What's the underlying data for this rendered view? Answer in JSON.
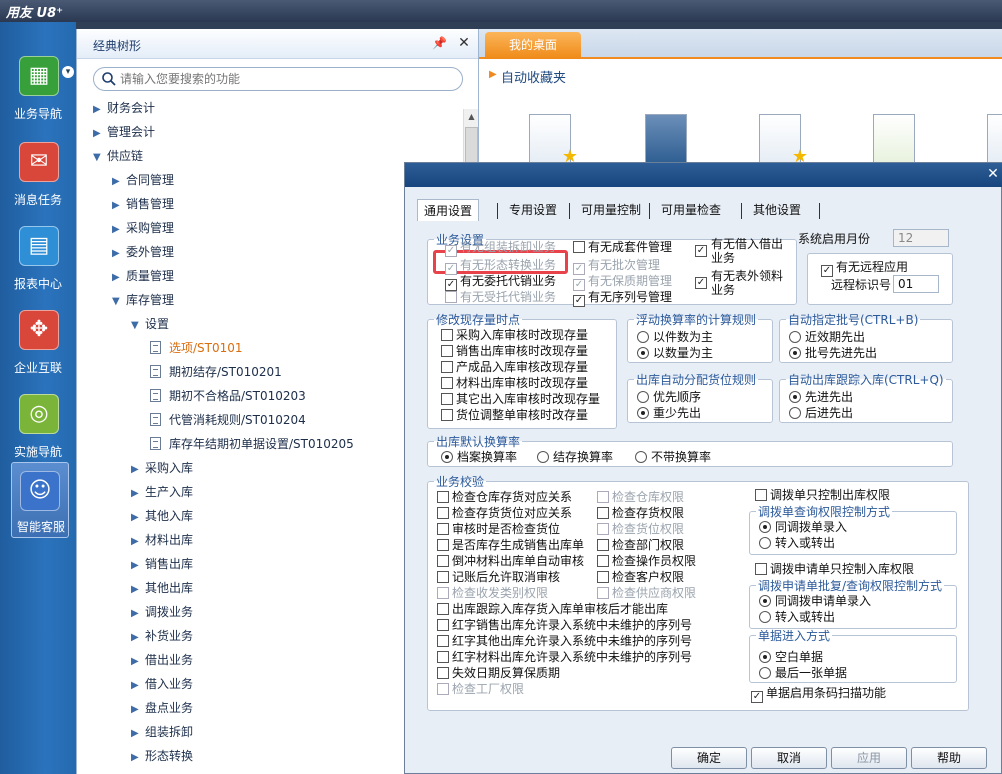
{
  "app": {
    "title": "用友 U8⁺"
  },
  "leftnav": {
    "items": [
      {
        "label": "业务导航",
        "icon": "grid-icon",
        "color": "#37a03a"
      },
      {
        "label": "消息任务",
        "icon": "mail-icon",
        "color": "#d9473a"
      },
      {
        "label": "报表中心",
        "icon": "report-icon",
        "color": "#2e8fd6"
      },
      {
        "label": "企业互联",
        "icon": "connect-icon",
        "color": "#d9473a"
      },
      {
        "label": "实施导航",
        "icon": "compass-icon",
        "color": "#7ab53a"
      },
      {
        "label": "智能客服",
        "icon": "headset-icon",
        "color": "#3a73c9"
      }
    ]
  },
  "tree": {
    "title": "经典树形",
    "search_placeholder": "请输入您要搜索的功能",
    "items": [
      {
        "label": "财务会计",
        "level": 0,
        "expanded": false
      },
      {
        "label": "管理会计",
        "level": 0,
        "expanded": false
      },
      {
        "label": "供应链",
        "level": 0,
        "expanded": true
      },
      {
        "label": "合同管理",
        "level": 1,
        "expanded": false
      },
      {
        "label": "销售管理",
        "level": 1,
        "expanded": false
      },
      {
        "label": "采购管理",
        "level": 1,
        "expanded": false
      },
      {
        "label": "委外管理",
        "level": 1,
        "expanded": false
      },
      {
        "label": "质量管理",
        "level": 1,
        "expanded": false
      },
      {
        "label": "库存管理",
        "level": 1,
        "expanded": true
      },
      {
        "label": "设置",
        "level": 2,
        "expanded": true
      },
      {
        "label": "选项/ST0101",
        "level": 3,
        "leaf": true,
        "selected": true
      },
      {
        "label": "期初结存/ST010201",
        "level": 3,
        "leaf": true
      },
      {
        "label": "期初不合格品/ST010203",
        "level": 3,
        "leaf": true
      },
      {
        "label": "代管消耗规则/ST010204",
        "level": 3,
        "leaf": true
      },
      {
        "label": "库存年结期初单据设置/ST010205",
        "level": 3,
        "leaf": true
      },
      {
        "label": "采购入库",
        "level": 2,
        "expanded": false
      },
      {
        "label": "生产入库",
        "level": 2,
        "expanded": false
      },
      {
        "label": "其他入库",
        "level": 2,
        "expanded": false
      },
      {
        "label": "材料出库",
        "level": 2,
        "expanded": false
      },
      {
        "label": "销售出库",
        "level": 2,
        "expanded": false
      },
      {
        "label": "其他出库",
        "level": 2,
        "expanded": false
      },
      {
        "label": "调拨业务",
        "level": 2,
        "expanded": false
      },
      {
        "label": "补货业务",
        "level": 2,
        "expanded": false
      },
      {
        "label": "借出业务",
        "level": 2,
        "expanded": false
      },
      {
        "label": "借入业务",
        "level": 2,
        "expanded": false
      },
      {
        "label": "盘点业务",
        "level": 2,
        "expanded": false
      },
      {
        "label": "组装拆卸",
        "level": 2,
        "expanded": false
      },
      {
        "label": "形态转换",
        "level": 2,
        "expanded": false
      }
    ]
  },
  "desktop": {
    "tab_label": "我的桌面",
    "favorites_label": "自动收藏夹"
  },
  "dialog": {
    "tabs": [
      "通用设置",
      "专用设置",
      "可用量控制",
      "可用量检查",
      "其他设置"
    ],
    "biz": {
      "legend": "业务设置",
      "col1": [
        {
          "label": "有无组装拆卸业务",
          "checked": true,
          "disabled": true
        },
        {
          "label": "有无形态转换业务",
          "checked": true,
          "disabled": true
        },
        {
          "label": "有无委托代销业务",
          "checked": true,
          "disabled": false
        },
        {
          "label": "有无受托代销业务",
          "checked": false,
          "disabled": true
        }
      ],
      "col2": [
        {
          "label": "有无成套件管理",
          "checked": false,
          "disabled": false
        },
        {
          "label": "有无批次管理",
          "checked": true,
          "disabled": true
        },
        {
          "label": "有无保质期管理",
          "checked": true,
          "disabled": true
        },
        {
          "label": "有无序列号管理",
          "checked": true,
          "disabled": false
        }
      ],
      "col3": [
        {
          "label": "有无借入借出业务",
          "checked": true
        },
        {
          "label": "有无表外领料业务",
          "checked": true
        }
      ]
    },
    "sys_month": {
      "label": "系统启用月份",
      "value": "12"
    },
    "remote": {
      "label": "有无远程应用",
      "checked": true,
      "id_label": "远程标识号",
      "id_value": "01"
    },
    "stock_update": {
      "legend": "修改现存量时点",
      "items": [
        "采购入库审核时改现存量",
        "销售出库审核时改现存量",
        "产成品入库审核改现存量",
        "材料出库审核时改现存量",
        "其它出入库审核时改现存量",
        "货位调整单审核时改存量"
      ]
    },
    "float_rule": {
      "legend": "浮动换算率的计算规则",
      "options": [
        "以件数为主",
        "以数量为主"
      ],
      "selected": 1
    },
    "batch_rule": {
      "legend": "自动指定批号(CTRL+B)",
      "options": [
        "近效期先出",
        "批号先进先出"
      ],
      "selected": 1
    },
    "loc_rule": {
      "legend": "出库自动分配货位规则",
      "options": [
        "优先顺序",
        "重少先出"
      ],
      "selected": 1
    },
    "track_rule": {
      "legend": "自动出库跟踪入库(CTRL+Q)",
      "options": [
        "先进先出",
        "后进先出"
      ],
      "selected": 0
    },
    "conv_rate": {
      "legend": "出库默认换算率",
      "options": [
        "档案换算率",
        "结存换算率",
        "不带换算率"
      ],
      "selected": 0
    },
    "verify": {
      "legend": "业务校验",
      "col1": [
        {
          "label": "检查仓库存货对应关系",
          "checked": false,
          "disabled": false
        },
        {
          "label": "检查存货货位对应关系",
          "checked": false,
          "disabled": false
        },
        {
          "label": "审核时是否检查货位",
          "checked": false,
          "disabled": false
        },
        {
          "label": "是否库存生成销售出库单",
          "checked": false,
          "disabled": false
        },
        {
          "label": "倒冲材料出库单自动审核",
          "checked": false,
          "disabled": false
        },
        {
          "label": "记账后允许取消审核",
          "checked": false,
          "disabled": false
        },
        {
          "label": "检查收发类别权限",
          "checked": false,
          "disabled": true
        }
      ],
      "col2": [
        {
          "label": "检查仓库权限",
          "checked": false,
          "disabled": true
        },
        {
          "label": "检查存货权限",
          "checked": false,
          "disabled": false
        },
        {
          "label": "检查货位权限",
          "checked": false,
          "disabled": true
        },
        {
          "label": "检查部门权限",
          "checked": false,
          "disabled": false
        },
        {
          "label": "检查操作员权限",
          "checked": false,
          "disabled": false
        },
        {
          "label": "检查客户权限",
          "checked": false,
          "disabled": false
        },
        {
          "label": "检查供应商权限",
          "checked": false,
          "disabled": true
        }
      ],
      "wide": [
        {
          "label": "出库跟踪入库存货入库单审核后才能出库",
          "checked": false,
          "disabled": false
        },
        {
          "label": "红字销售出库允许录入系统中未维护的序列号",
          "checked": false,
          "disabled": false
        },
        {
          "label": "红字其他出库允许录入系统中未维护的序列号",
          "checked": false,
          "disabled": false
        },
        {
          "label": "红字材料出库允许录入系统中未维护的序列号",
          "checked": false,
          "disabled": false
        },
        {
          "label": "失效日期反算保质期",
          "checked": false,
          "disabled": false
        },
        {
          "label": "检查工厂权限",
          "checked": false,
          "disabled": true
        }
      ]
    },
    "transfer_out": {
      "label": "调拨单只控制出库权限",
      "checked": false
    },
    "transfer_query": {
      "legend": "调拨单查询权限控制方式",
      "options": [
        "同调拨单录入",
        "转入或转出"
      ],
      "selected": 0
    },
    "transfer_req_in": {
      "label": "调拨申请单只控制入库权限",
      "checked": false
    },
    "transfer_req_query": {
      "legend": "调拨申请单批复/查询权限控制方式",
      "options": [
        "同调拨申请单录入",
        "转入或转出"
      ],
      "selected": 0
    },
    "doc_entry": {
      "legend": "单据进入方式",
      "options": [
        "空白单据",
        "最后一张单据"
      ],
      "selected": 0
    },
    "barcode": {
      "label": "单据启用条码扫描功能",
      "checked": true
    },
    "buttons": {
      "ok": "确定",
      "cancel": "取消",
      "apply": "应用",
      "help": "帮助"
    }
  }
}
